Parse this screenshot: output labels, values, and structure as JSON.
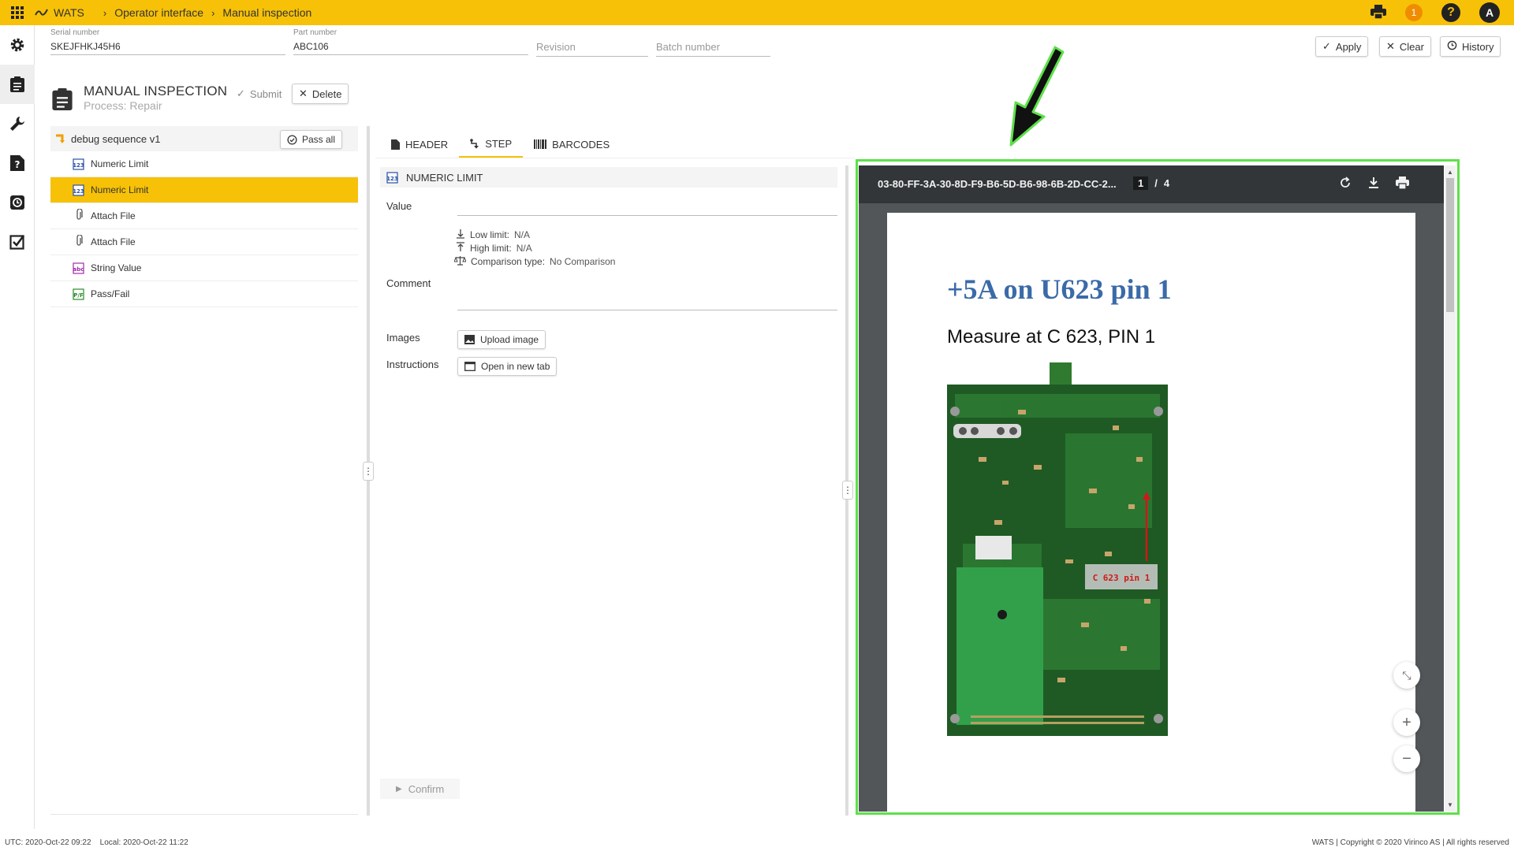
{
  "topbar": {
    "brand": "WATS",
    "breadcrumbs": [
      "Operator interface",
      "Manual inspection"
    ],
    "notification_count": "1",
    "help_label": "?",
    "avatar_initial": "A"
  },
  "fields": {
    "serial_label": "Serial number",
    "serial_value": "SKEJFHKJ45H6",
    "part_label": "Part number",
    "part_value": "ABC106",
    "revision_placeholder": "Revision",
    "batch_placeholder": "Batch number"
  },
  "actions": {
    "apply": "Apply",
    "clear": "Clear",
    "history": "History"
  },
  "inspection": {
    "title": "MANUAL INSPECTION",
    "process": "Process: Repair",
    "submit": "Submit",
    "delete": "Delete"
  },
  "sequence": {
    "name": "debug sequence v1",
    "pass_all": "Pass all",
    "steps": [
      {
        "label": "Numeric Limit",
        "icon": "numeric-limit-icon"
      },
      {
        "label": "Numeric Limit",
        "icon": "numeric-limit-icon"
      },
      {
        "label": "Attach File",
        "icon": "paperclip-icon"
      },
      {
        "label": "Attach File",
        "icon": "paperclip-icon"
      },
      {
        "label": "String Value",
        "icon": "string-value-icon"
      },
      {
        "label": "Pass/Fail",
        "icon": "pass-fail-icon"
      }
    ],
    "selected_index": 1
  },
  "tabs": [
    "HEADER",
    "STEP",
    "BARCODES"
  ],
  "active_tab": "STEP",
  "step": {
    "type": "NUMERIC LIMIT",
    "value_label": "Value",
    "low_limit_label": "Low limit:",
    "low_limit_value": "N/A",
    "high_limit_label": "High limit:",
    "high_limit_value": "N/A",
    "comparison_label": "Comparison type:",
    "comparison_value": "No Comparison",
    "comment_label": "Comment",
    "images_label": "Images",
    "upload_image": "Upload image",
    "instructions_label": "Instructions",
    "open_new_tab": "Open in new tab",
    "confirm": "Confirm"
  },
  "viewer": {
    "file_name": "03-80-FF-3A-30-8D-F9-B6-5D-B6-98-6B-2D-CC-2...",
    "current_page": "1",
    "page_sep": "/",
    "total_pages": "4",
    "heading": "+5A on U623 pin 1",
    "text": "Measure at C 623, PIN 1",
    "board_label": "C 623 pin 1"
  },
  "footer": {
    "utc_label": "UTC:",
    "utc_value": "2020-Oct-22 09:22",
    "local_label": "Local:",
    "local_value": "2020-Oct-22 11:22",
    "copyright": "WATS | Copyright © 2020 Virinco AS | All rights reserved"
  },
  "colors": {
    "accent": "#f7c107",
    "highlight": "#5ee04a",
    "pdf_heading": "#3b6aa8"
  }
}
